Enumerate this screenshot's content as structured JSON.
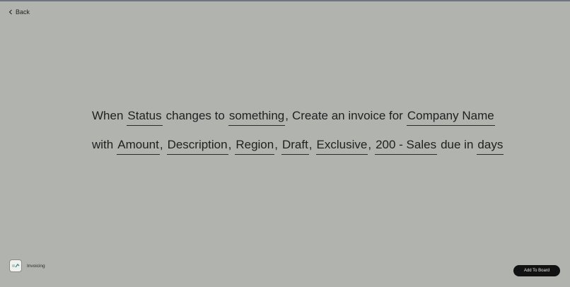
{
  "nav": {
    "back_label": "Back"
  },
  "sentence": {
    "line1": {
      "when": "When",
      "trigger_field": "Status",
      "changes_to": "changes to",
      "trigger_value": "something",
      "comma1": ",",
      "create_text": "Create an invoice for",
      "company_field": "Company Name"
    },
    "line2": {
      "with": "with",
      "fields": [
        "Amount",
        "Description",
        "Region",
        "Draft",
        "Exclusive",
        "200 - Sales"
      ],
      "due_in": "due in",
      "days_field": "days"
    }
  },
  "integration": {
    "icon": "invoicing-app-icon",
    "name": "Invoicing"
  },
  "actions": {
    "add_to_board_label": "Add To Board"
  },
  "colors": {
    "background": "#b1b3af",
    "button": "#111211",
    "top_border": "#6f7382"
  }
}
